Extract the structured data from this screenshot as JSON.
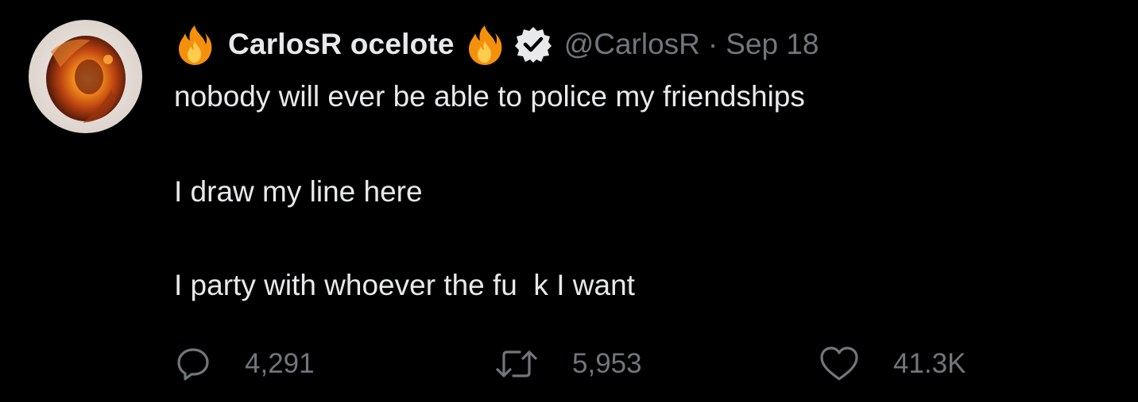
{
  "tweet": {
    "display_name": "CarlosR ocelote",
    "name_emoji_left": "fire-emoji",
    "name_emoji_right": "fire-emoji",
    "verified_icon": "verified-badge-icon",
    "handle": "@CarlosR",
    "separator": "·",
    "timestamp": "Sep 18",
    "lines": [
      "nobody will ever be able to police my friendships",
      "I draw my line here",
      "I party with whoever the fu  k I want"
    ]
  },
  "actions": {
    "reply": {
      "icon": "reply-icon",
      "count": "4,291"
    },
    "retweet": {
      "icon": "retweet-icon",
      "count": "5,953"
    },
    "like": {
      "icon": "heart-icon",
      "count": "41.3K"
    }
  },
  "colors": {
    "background": "#000000",
    "text_primary": "#e7e9ea",
    "text_secondary": "#71767b"
  }
}
